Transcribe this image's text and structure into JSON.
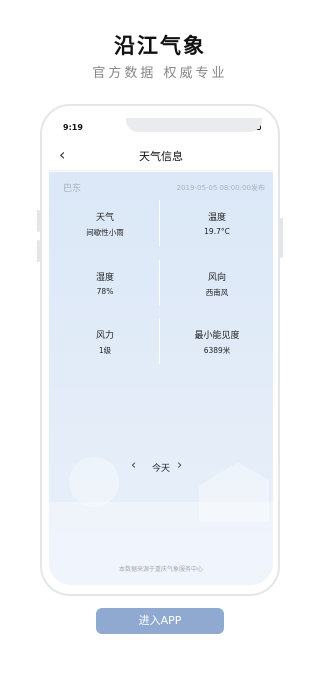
{
  "promo": {
    "title": "沿江气象",
    "subtitle": "官方数据 权威专业"
  },
  "status_bar": {
    "time": "9:19",
    "signal": "⊿ ≋"
  },
  "nav": {
    "back_icon": "‹",
    "title": "天气信息"
  },
  "header": {
    "city": "巴东",
    "publish_time": "2019-05-05 08:00:00发布"
  },
  "weather": [
    {
      "label": "天气",
      "value": "间歇性小雨"
    },
    {
      "label": "温度",
      "value": "19.7°C"
    },
    {
      "label": "湿度",
      "value": "78%"
    },
    {
      "label": "风向",
      "value": "西南风"
    },
    {
      "label": "风力",
      "value": "1级"
    },
    {
      "label": "最小能见度",
      "value": "6389米"
    }
  ],
  "day_switch": {
    "prev_icon": "‹",
    "label": "今天",
    "next_icon": "›"
  },
  "source": "本数据来源于重庆气象服务中心",
  "enter_button": "进入APP",
  "colors": {
    "accent": "#8fa9d1",
    "background": "#dbe8f7"
  }
}
